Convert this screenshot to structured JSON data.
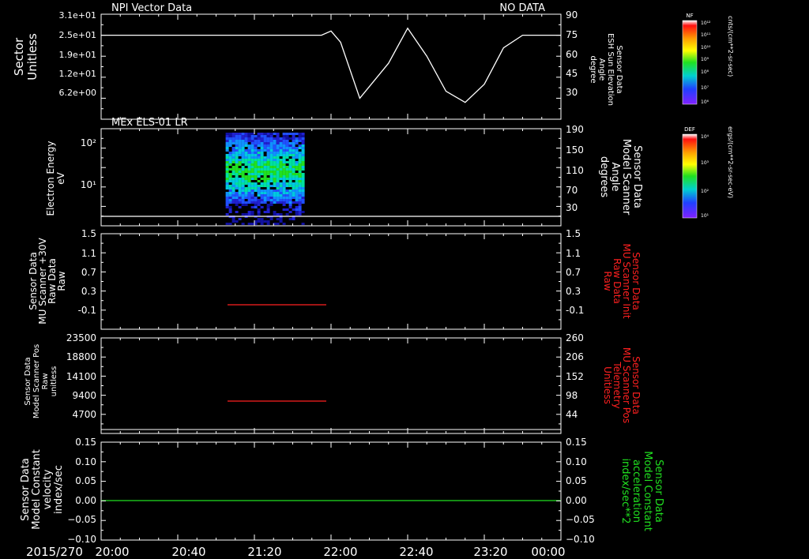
{
  "colors": {
    "background": "#000000",
    "axis": "#ffffff",
    "trace_white": "#ffffff",
    "trace_red": "#ff2020",
    "trace_green": "#20e020",
    "label_red": "#ff2020",
    "label_green": "#20e020"
  },
  "chart_data": [
    {
      "type": "line",
      "title_left": "NPI Vector Data",
      "title_right": "NO DATA",
      "ylabel": [
        "Sector",
        "Unitless"
      ],
      "yticks": [
        "3.1e+01",
        "2.5e+01",
        "1.9e+01",
        "1.2e+01",
        "6.2e+00"
      ],
      "ylabel_right": [
        "Sensor Data",
        "ESH Sun Elevation",
        "Angle",
        "degree"
      ],
      "yticks_right": [
        "90",
        "75",
        "60",
        "45",
        "30"
      ],
      "ylim_right": [
        15,
        90
      ],
      "series": [
        {
          "color": "#ffffff",
          "x": [
            "20:00",
            "21:55",
            "22:00",
            "22:05",
            "22:15",
            "22:30",
            "22:40",
            "22:50",
            "23:00",
            "23:10",
            "23:20",
            "23:30",
            "23:40",
            "00:00"
          ],
          "y": [
            75,
            75,
            78,
            70,
            30,
            55,
            80,
            60,
            35,
            27,
            40,
            66,
            75,
            75
          ]
        }
      ],
      "colorbar": {
        "label": "NF",
        "units": "cnts/(cm**2-sr-sec)",
        "ticks": [
          "10¹²",
          "10¹¹",
          "10¹⁰",
          "10⁹",
          "10⁸",
          "10⁷",
          "10⁶"
        ]
      }
    },
    {
      "type": "heatmap",
      "title_left": "MEx ELS-01 LR",
      "ylabel": [
        "Electron Energy",
        "eV"
      ],
      "yticks": [
        "10²",
        "10¹"
      ],
      "ylabel_right": [
        "Sensor Data",
        "Model Scanner",
        "Angle",
        "degrees"
      ],
      "yticks_right": [
        "190",
        "150",
        "110",
        "70",
        "30"
      ],
      "ylim_right": [
        0,
        190
      ],
      "spectrogram_time_range": [
        "21:05",
        "21:45"
      ],
      "series": [
        {
          "color": "#ffffff",
          "x": [
            "20:00",
            "00:00"
          ],
          "y": [
            10,
            10
          ]
        }
      ],
      "colorbar": {
        "label": "DEF",
        "units": "ergs/(cm**2-sr-sec-eV)",
        "ticks": [
          "10⁴",
          "10³",
          "10²",
          "10¹"
        ]
      }
    },
    {
      "type": "line",
      "ylabel": [
        "Sensor Data",
        "MU Scanner +30V",
        "Raw Data",
        "Raw"
      ],
      "yticks": [
        "1.5",
        "1.1",
        "0.7",
        "0.3",
        "-0.1"
      ],
      "ylim": [
        -0.3,
        1.5
      ],
      "ylabel_right": [
        "Sensor Data",
        "MU Scanner Init",
        "Raw Data",
        "Raw"
      ],
      "yticks_right": [
        "1.5",
        "1.1",
        "0.7",
        "0.3",
        "-0.1"
      ],
      "series": [
        {
          "color": "#ff2020",
          "x": [
            "21:00",
            "21:50"
          ],
          "y": [
            0.0,
            0.0
          ]
        }
      ]
    },
    {
      "type": "line",
      "ylabel": [
        "Sensor Data",
        "Model Scanner Pos",
        "Raw",
        "unitless"
      ],
      "yticks": [
        "23500",
        "18800",
        "14100",
        "9400",
        "4700"
      ],
      "ylim": [
        0,
        23500
      ],
      "ylabel_right": [
        "Sensor Data",
        "MU Scanner Pos",
        "Telemetry",
        "Unitless"
      ],
      "yticks_right": [
        "260",
        "206",
        "152",
        "98",
        "44"
      ],
      "series": [
        {
          "color": "#ff2020",
          "x": [
            "21:00",
            "21:50"
          ],
          "y": [
            8200,
            8200
          ]
        }
      ]
    },
    {
      "type": "line",
      "ylabel": [
        "Sensor Data",
        "Model Constant",
        "velocity",
        "index/sec"
      ],
      "yticks": [
        "0.15",
        "0.10",
        "0.05",
        "0.00",
        "−0.05",
        "−0.10"
      ],
      "ylim": [
        -0.1,
        0.15
      ],
      "ylabel_right": [
        "Sensor Data",
        "Model Constant",
        "acceleration",
        "index/sec**2"
      ],
      "yticks_right": [
        "0.15",
        "0.10",
        "0.05",
        "0.00",
        "−0.05",
        "−0.10"
      ],
      "series": [
        {
          "color": "#20e020",
          "x": [
            "20:00",
            "00:00"
          ],
          "y": [
            0.0,
            0.0
          ]
        }
      ]
    }
  ],
  "time_axis": {
    "date_label": "2015/270",
    "ticks": [
      "20:00",
      "20:40",
      "21:20",
      "22:00",
      "22:40",
      "23:20",
      "00:00"
    ]
  }
}
